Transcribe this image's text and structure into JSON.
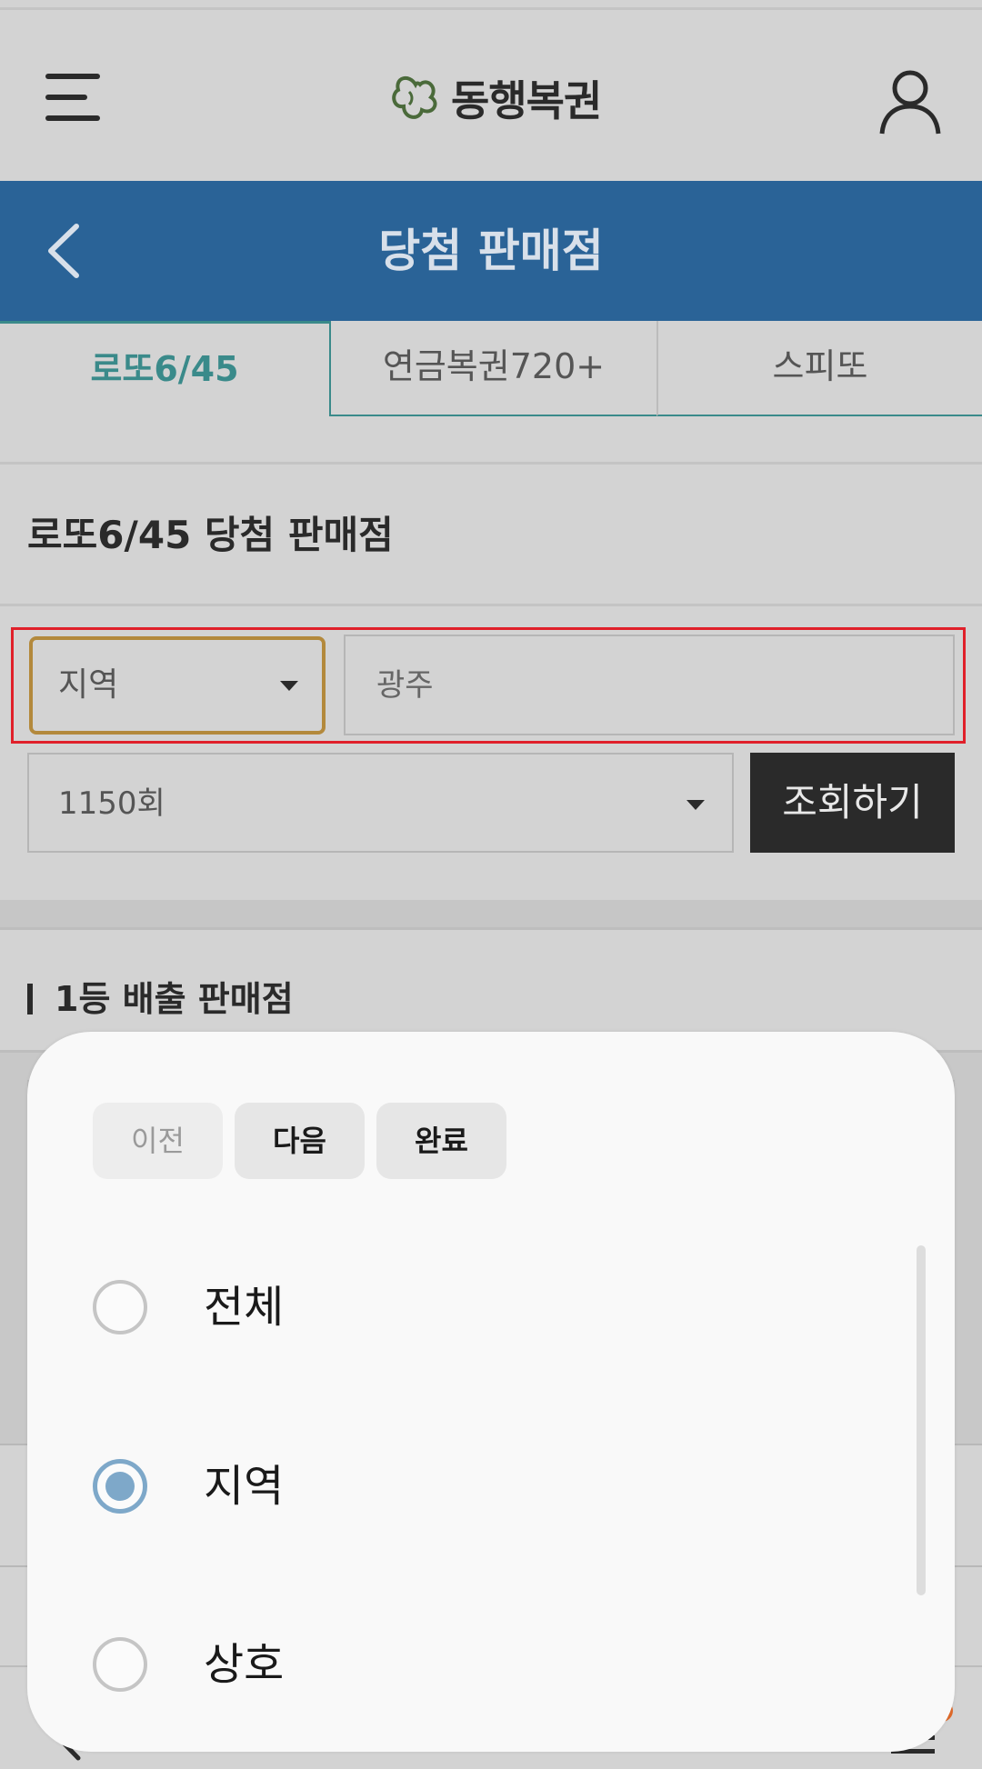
{
  "header": {
    "app_name": "동행복권"
  },
  "titlebar": {
    "title": "당첨 판매점"
  },
  "tabs": [
    {
      "label": "로또6/45",
      "active": true
    },
    {
      "label": "연금복권720+",
      "active": false
    },
    {
      "label": "스피또",
      "active": false
    }
  ],
  "section": {
    "title": "로또6/45 당첨 판매점"
  },
  "filters": {
    "type_select": "지역",
    "region_input": {
      "value": "",
      "placeholder": "광주"
    },
    "round_select": "1150회",
    "search_label": "조회하기"
  },
  "results": {
    "subtitle": "1등 배출 판매점"
  },
  "picker": {
    "prev_label": "이전",
    "next_label": "다음",
    "done_label": "완료",
    "options": [
      {
        "label": "전체",
        "selected": false
      },
      {
        "label": "지역",
        "selected": true
      },
      {
        "label": "상호",
        "selected": false
      }
    ]
  },
  "colors": {
    "brand_blue": "#2a6397",
    "tab_active": "#3a8a8a",
    "highlight": "#e0202a",
    "focus_border": "#b3893c",
    "radio_selected": "#7ea8c9"
  }
}
